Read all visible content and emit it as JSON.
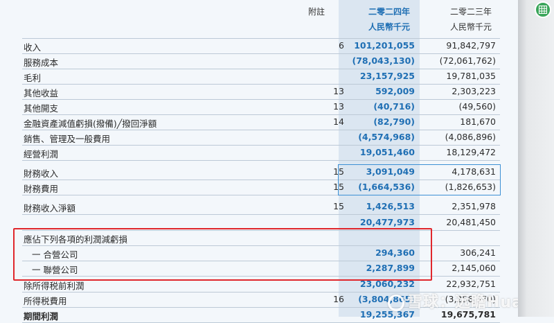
{
  "header": {
    "note_col": "附註",
    "cur_year": "二零二四年",
    "cur_unit": "人民幣千元",
    "prev_year": "二零二三年",
    "prev_unit": "人民幣千元"
  },
  "rows": [
    {
      "label": "收入",
      "note": "6",
      "cur": "101,201,055",
      "prev": "91,842,797"
    },
    {
      "label": "服務成本",
      "note": "",
      "cur": "(78,043,130)",
      "prev": "(72,061,762)"
    },
    {
      "label": "毛利",
      "note": "",
      "cur": "23,157,925",
      "prev": "19,781,035"
    },
    {
      "label": "其他收益",
      "note": "13",
      "cur": "592,009",
      "prev": "2,303,223"
    },
    {
      "label": "其他開支",
      "note": "13",
      "cur": "(40,716)",
      "prev": "(49,560)"
    },
    {
      "label": "金融資產減值虧損(撥備)╱撥回淨額",
      "note": "14",
      "cur": "(82,790)",
      "prev": "181,670"
    },
    {
      "label": "銷售、管理及一般費用",
      "note": "",
      "cur": "(4,574,968)",
      "prev": "(4,086,896)"
    },
    {
      "label": "經營利潤",
      "note": "",
      "cur": "19,051,460",
      "prev": "18,129,472"
    },
    {
      "label": "財務收入",
      "note": "15",
      "cur": "3,091,049",
      "prev": "4,178,631"
    },
    {
      "label": "財務費用",
      "note": "15",
      "cur": "(1,664,536)",
      "prev": "(1,826,653)"
    },
    {
      "label": "財務收入淨額",
      "note": "15",
      "cur": "1,426,513",
      "prev": "2,351,978"
    },
    {
      "label": "",
      "note": "",
      "cur": "20,477,973",
      "prev": "20,481,450"
    },
    {
      "label": "應佔下列各項的利潤減虧損",
      "note": "",
      "cur": "",
      "prev": ""
    },
    {
      "label": "一 合營公司",
      "note": "",
      "cur": "294,360",
      "prev": "306,241"
    },
    {
      "label": "一 聯營公司",
      "note": "",
      "cur": "2,287,899",
      "prev": "2,145,060"
    },
    {
      "label": "除所得税前利潤",
      "note": "",
      "cur": "23,060,232",
      "prev": "22,932,751"
    },
    {
      "label": "所得税費用",
      "note": "16",
      "cur": "(3,804,865)",
      "prev": "(3,256,970)"
    },
    {
      "label": "期間利潤",
      "note": "",
      "cur": "19,255,367",
      "prev": "19,675,781"
    }
  ],
  "watermark": "雪球：远瞻Huang",
  "colors": {
    "accent_blue": "#1f6fb4",
    "highlight_column": "#dbe6f1",
    "red_box": "#e0262b",
    "app_icon": "#3aa55a"
  },
  "icons": {
    "app": "spreadsheet-icon",
    "watermark_logo": "snowball-logo-icon"
  }
}
